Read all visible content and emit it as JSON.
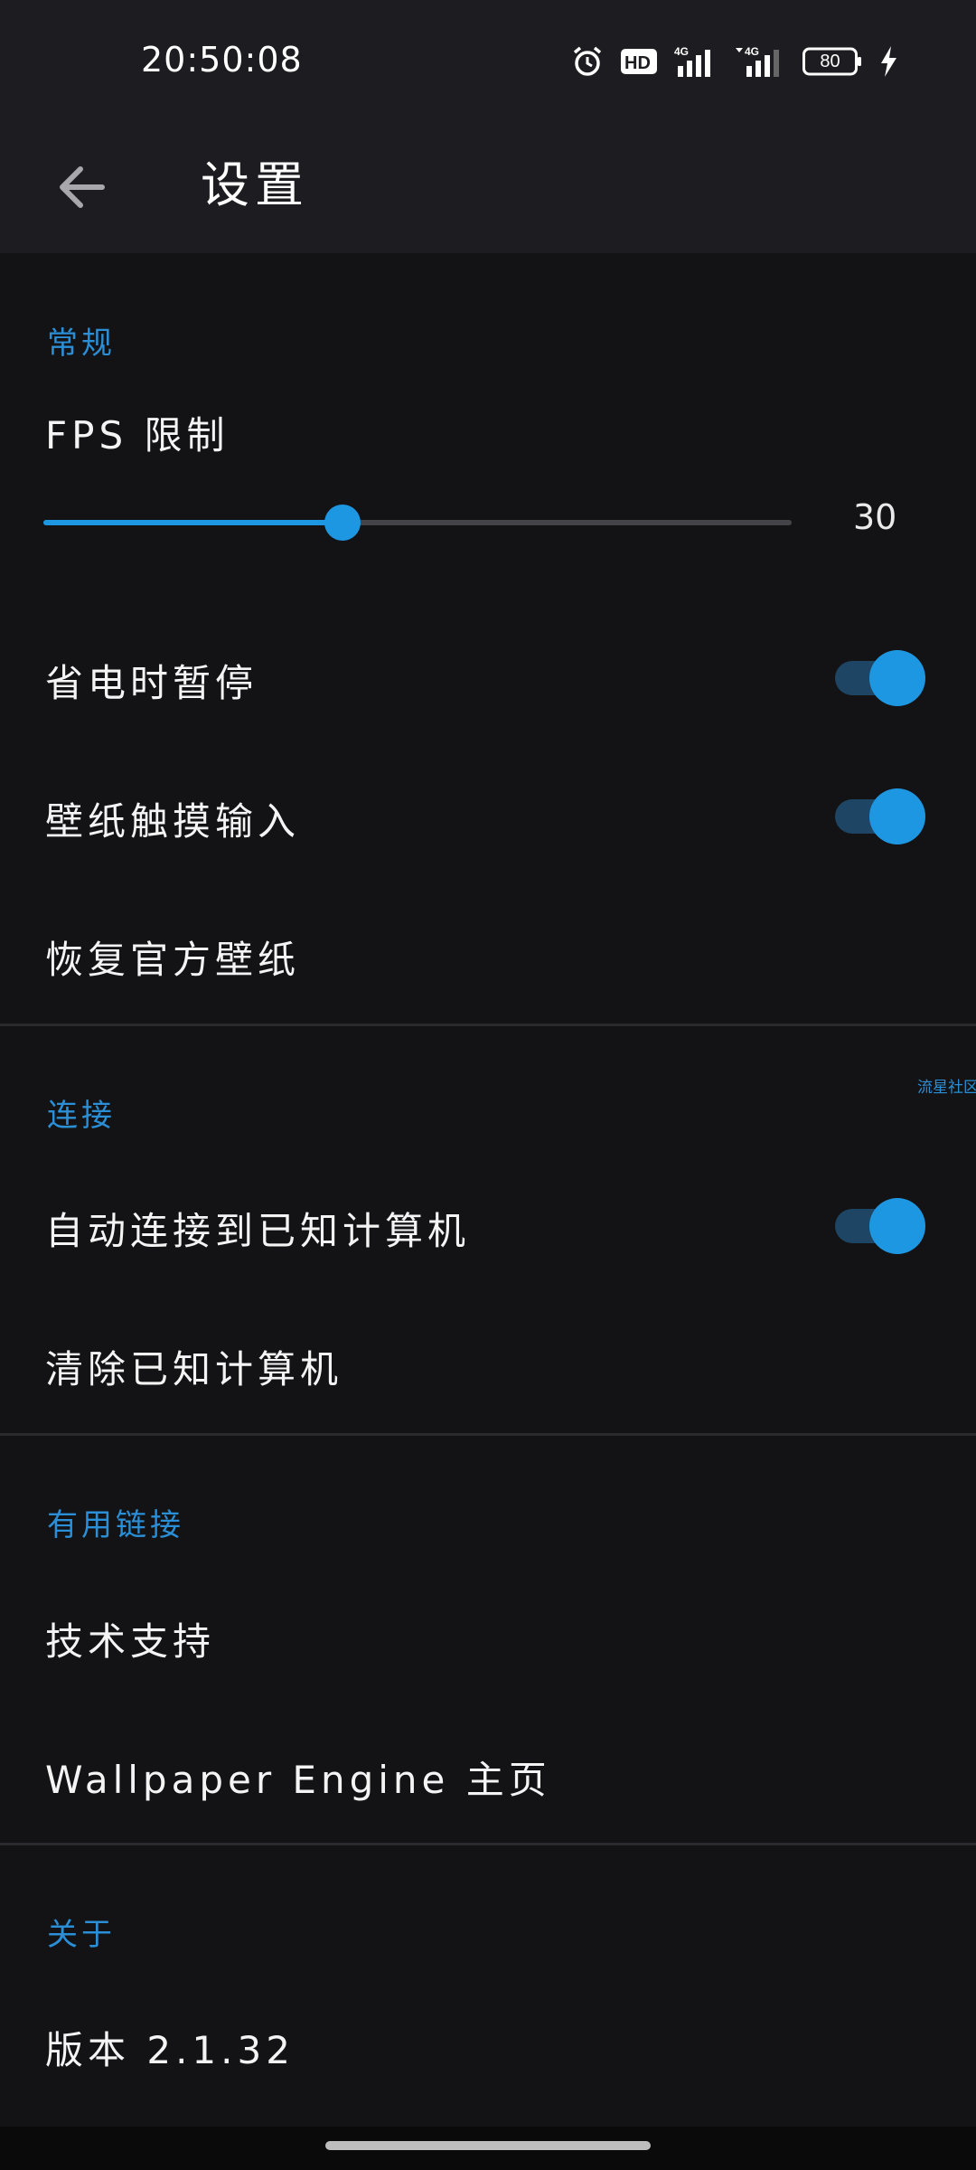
{
  "status_bar": {
    "time": "20:50:08",
    "network_1": "4G",
    "network_2": "4G",
    "battery": "80",
    "icons": [
      "alarm-icon",
      "hd-icon",
      "signal-icon",
      "signal-icon",
      "battery-icon",
      "charging-icon"
    ]
  },
  "app_bar": {
    "title": "设置",
    "back_icon": "arrow-left-icon"
  },
  "sections": {
    "general": {
      "header": "常规",
      "fps_label": "FPS 限制",
      "fps_value": "30",
      "fps_fraction": 0.4,
      "pause_battery": {
        "label": "省电时暂停",
        "on": true
      },
      "touch_input": {
        "label": "壁纸触摸输入",
        "on": true
      },
      "restore": "恢复官方壁纸"
    },
    "connection": {
      "header": "连接",
      "auto_connect": {
        "label": "自动连接到已知计算机",
        "on": true
      },
      "clear": "清除已知计算机"
    },
    "links": {
      "header": "有用链接",
      "support": "技术支持",
      "homepage": "Wallpaper Engine 主页"
    },
    "about": {
      "header": "关于",
      "version": "版本 2.1.32"
    }
  },
  "watermark": "流星社区",
  "colors": {
    "accent": "#1e97e3",
    "header_text": "#2a8fd6",
    "background": "#131315",
    "bar_background": "#1d1d21"
  }
}
